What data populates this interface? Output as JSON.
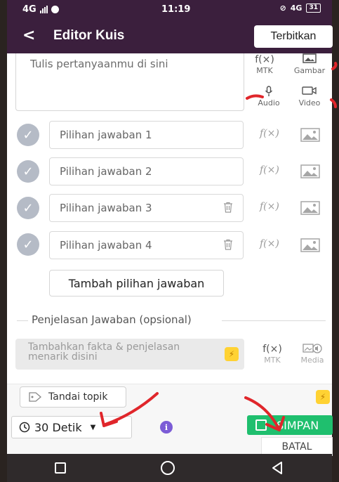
{
  "status_bar": {
    "network": "4G",
    "time": "11:19",
    "right_network": "4G",
    "battery": "31"
  },
  "header": {
    "back_glyph": "<",
    "title": "Editor Kuis",
    "publish_label": "Terbitkan"
  },
  "question": {
    "placeholder": "Tulis pertanyaanmu di sini",
    "tools": [
      {
        "label": "MTK",
        "glyph": "f(×)",
        "icon": "formula-icon"
      },
      {
        "label": "Gambar",
        "icon": "image-icon"
      },
      {
        "label": "Audio",
        "icon": "microphone-icon"
      },
      {
        "label": "Video",
        "icon": "video-camera-icon"
      }
    ]
  },
  "answers": [
    {
      "placeholder": "Pilihan jawaban 1",
      "deletable": false
    },
    {
      "placeholder": "Pilihan jawaban 2",
      "deletable": false
    },
    {
      "placeholder": "Pilihan jawaban 3",
      "deletable": true
    },
    {
      "placeholder": "Pilihan jawaban 4",
      "deletable": true
    }
  ],
  "answer_fx_glyph": "f(×)",
  "add_answer_label": "Tambah pilihan jawaban",
  "explanation": {
    "section_label": "Penjelasan Jawaban (opsional)",
    "placeholder": "Tambahkan fakta & penjelasan menarik disini",
    "tools": [
      {
        "label": "MTK",
        "glyph": "f(×)",
        "icon": "formula-icon"
      },
      {
        "label": "Media",
        "icon": "media-icon"
      }
    ]
  },
  "footer": {
    "topic_label": "Tandai topik",
    "timer_label": "30 Detik",
    "info_glyph": "i",
    "save_label": "SIMPAN",
    "cancel_label": "BATAL"
  },
  "colors": {
    "header_bg": "#3b1f3d",
    "save_green": "#1fbf6e",
    "bolt_yellow": "#ffd233",
    "info_purple": "#7b5cd6",
    "annotation_red": "#e0262b"
  }
}
